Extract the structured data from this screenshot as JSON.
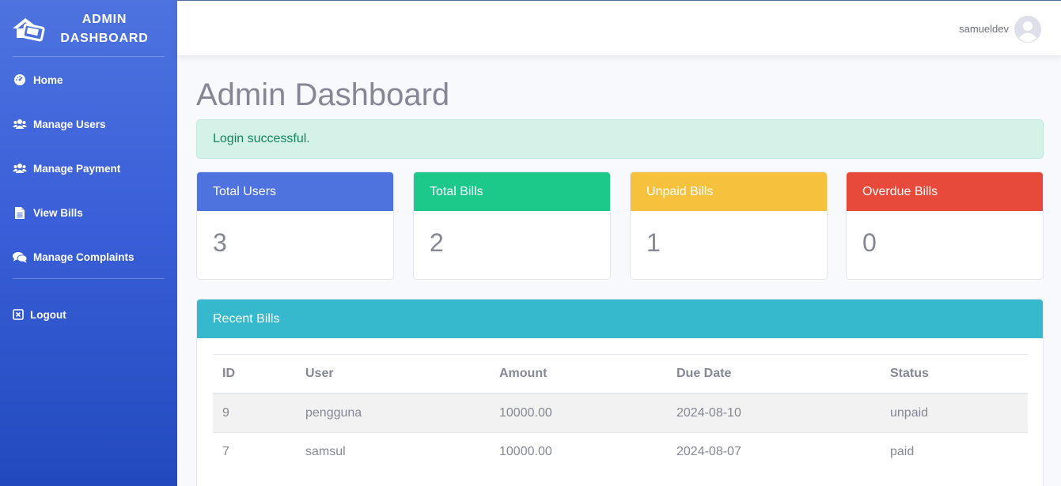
{
  "sidebar": {
    "brand": "ADMIN DASHBOARD",
    "items": [
      {
        "label": "Home",
        "icon": "dashboard-icon"
      },
      {
        "label": "Manage Users",
        "icon": "users-icon"
      },
      {
        "label": "Manage Payment",
        "icon": "users-icon"
      },
      {
        "label": "View Bills",
        "icon": "file-icon"
      },
      {
        "label": "Manage Complaints",
        "icon": "comments-icon"
      }
    ],
    "logout": {
      "label": "Logout",
      "icon": "close-box-icon"
    }
  },
  "topbar": {
    "username": "samueldev"
  },
  "main": {
    "title": "Admin Dashboard",
    "alert": "Login successful.",
    "cards": [
      {
        "label": "Total Users",
        "value": "3",
        "color": "#4e73df"
      },
      {
        "label": "Total Bills",
        "value": "2",
        "color": "#1cc88a"
      },
      {
        "label": "Unpaid Bills",
        "value": "1",
        "color": "#f6c23e"
      },
      {
        "label": "Overdue Bills",
        "value": "0",
        "color": "#e74a3b"
      }
    ],
    "recent_bills": {
      "title": "Recent Bills",
      "columns": [
        "ID",
        "User",
        "Amount",
        "Due Date",
        "Status"
      ],
      "rows": [
        [
          "9",
          "pengguna",
          "10000.00",
          "2024-08-10",
          "unpaid"
        ],
        [
          "7",
          "samsul",
          "10000.00",
          "2024-08-07",
          "paid"
        ]
      ]
    }
  }
}
